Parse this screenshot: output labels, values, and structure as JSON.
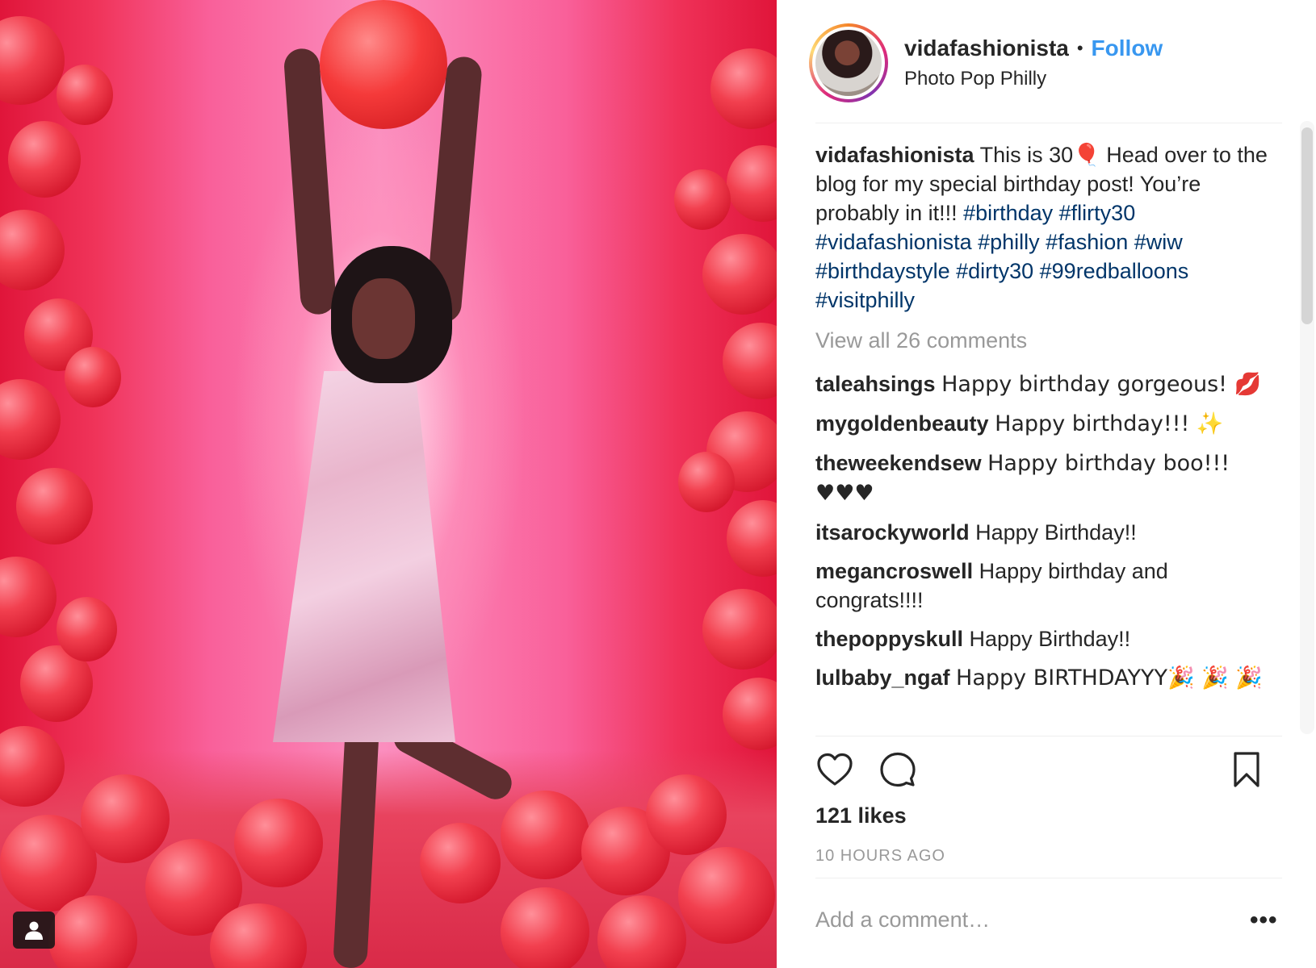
{
  "post": {
    "username": "vidafashionista",
    "separator": "•",
    "follow_label": "Follow",
    "location": "Photo Pop Philly"
  },
  "caption": {
    "username": "vidafashionista",
    "text": "This is 30🎈 Head over to the blog for my special birthday post! You’re probably in it!!! ",
    "hashtags": "#birthday #flirty30 #vidafashionista #philly #fashion #wiw #birthdaystyle #dirty30 #99redballoons #visitphilly"
  },
  "view_all_label": "View all 26 comments",
  "comments": [
    {
      "username": "taleahsings",
      "text": "Happy birthday gorgeous! 💋"
    },
    {
      "username": "mygoldenbeauty",
      "text": "Happy birthday!!! ✨"
    },
    {
      "username": "theweekendsew",
      "text": "Happy birthday boo!!! ♥♥♥"
    },
    {
      "username": "itsarockyworld",
      "text": "Happy Birthday!!"
    },
    {
      "username": "megancroswell",
      "text": "Happy birthday and congrats!!!!"
    },
    {
      "username": "thepoppyskull",
      "text": "Happy Birthday!!"
    },
    {
      "username": "lulbaby_ngaf",
      "text": "Happy BIRTHDAYYY🎉 🎉 🎉"
    }
  ],
  "likes_label": "121 likes",
  "time_label": "10 HOURS AGO",
  "add_comment_placeholder": "Add a comment…",
  "more_label": "•••",
  "icons": {
    "like": "heart-icon",
    "comment": "comment-bubble-icon",
    "save": "bookmark-icon",
    "tagged": "person-tag-icon"
  },
  "colors": {
    "follow": "#3897f0",
    "hashtag": "#003569",
    "muted": "#999999",
    "text": "#262626"
  }
}
